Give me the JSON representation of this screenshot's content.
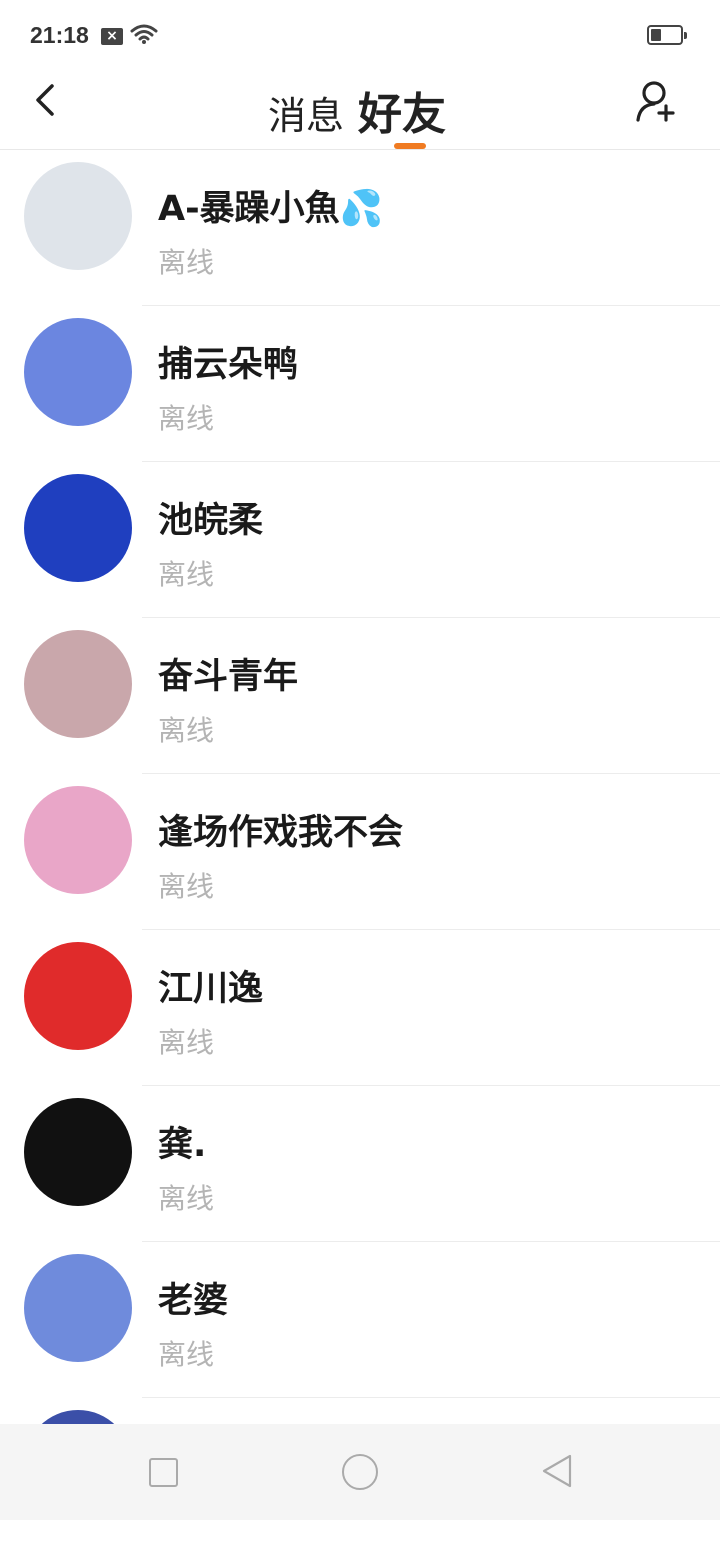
{
  "status_bar": {
    "time": "21:18",
    "sim_label": "×"
  },
  "header": {
    "tab_messages": "消息",
    "tab_friends": "好友",
    "accent_color": "#f07b22"
  },
  "friends": [
    {
      "name": "A-暴躁小魚💦",
      "status": "离线",
      "avatar_color": "#dfe4ea"
    },
    {
      "name": "捕云朵鸭",
      "status": "离线",
      "avatar_color": "#6b86e0"
    },
    {
      "name": "池皖柔",
      "status": "离线",
      "avatar_color": "#1f3fbf"
    },
    {
      "name": "奋斗青年",
      "status": "离线",
      "avatar_color": "#c9a7ab"
    },
    {
      "name": "逢场作戏我不会",
      "status": "离线",
      "avatar_color": "#e9a6c8"
    },
    {
      "name": "江川逸",
      "status": "离线",
      "avatar_color": "#e02b2b"
    },
    {
      "name": "龚.",
      "status": "离线",
      "avatar_color": "#111111"
    },
    {
      "name": "老婆",
      "status": "离线",
      "avatar_color": "#6f8bdc"
    }
  ],
  "icons": {
    "back": "chevron-left-icon",
    "add_friend": "add-user-icon",
    "nav_recent": "square-icon",
    "nav_home": "circle-icon",
    "nav_back": "triangle-back-icon"
  }
}
